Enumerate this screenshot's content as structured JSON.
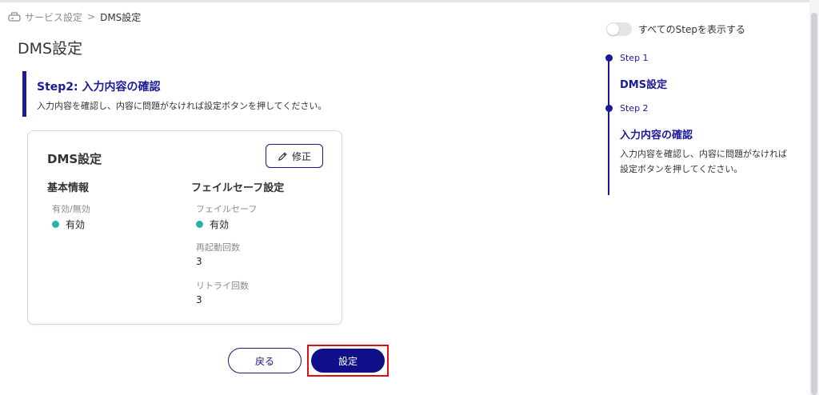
{
  "breadcrumb": {
    "parent": "サービス設定",
    "separator": ">",
    "current": "DMS設定",
    "icon": "router-icon"
  },
  "page": {
    "title": "DMS設定"
  },
  "step": {
    "heading": "Step2: 入力内容の確認",
    "description": "入力内容を確認し、内容に問題がなければ設定ボタンを押してください。"
  },
  "card": {
    "title": "DMS設定",
    "edit_label": "修正",
    "edit_icon": "pencil-icon",
    "basic": {
      "heading": "基本情報",
      "fields": [
        {
          "label": "有効/無効",
          "value": "有効",
          "status_color": "#25b5a6"
        }
      ]
    },
    "failsafe": {
      "heading": "フェイルセーフ設定",
      "fields": [
        {
          "label": "フェイルセーフ",
          "value": "有効",
          "status_color": "#25b5a6"
        },
        {
          "label": "再起動回数",
          "value": "3"
        },
        {
          "label": "リトライ回数",
          "value": "3"
        }
      ]
    }
  },
  "actions": {
    "back_label": "戻る",
    "submit_label": "設定"
  },
  "sidebar": {
    "toggle_label": "すべてのStepを表示する",
    "toggle_on": false,
    "steps": [
      {
        "label": "Step 1",
        "title": "DMS設定"
      },
      {
        "label": "Step 2",
        "title": "入力内容の確認",
        "description": "入力内容を確認し、内容に問題がなければ設定ボタンを押してください。"
      }
    ]
  },
  "colors": {
    "accent": "#1a1a9a",
    "highlight": "#e01010",
    "status": "#25b5a6"
  }
}
